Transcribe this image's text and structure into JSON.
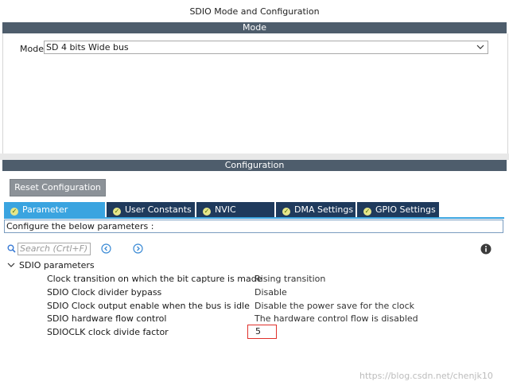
{
  "window": {
    "title": "SDIO Mode and Configuration"
  },
  "mode_section": {
    "header": "Mode",
    "mode_label": "Mode",
    "mode_value": "SD 4 bits Wide bus"
  },
  "config_section": {
    "header": "Configuration",
    "reset_button": "Reset Configuration",
    "tabs": [
      {
        "label": "Parameter Settings",
        "active": true
      },
      {
        "label": "User Constants",
        "active": false
      },
      {
        "label": "NVIC Settings",
        "active": false
      },
      {
        "label": "DMA Settings",
        "active": false
      },
      {
        "label": "GPIO Settings",
        "active": false
      }
    ],
    "configure_text": "Configure the below parameters :",
    "search_placeholder": "Search (Crtl+F)",
    "group_label": "SDIO parameters",
    "parameters": [
      {
        "name": "Clock transition on which the bit capture is made",
        "value": "Rising transition"
      },
      {
        "name": "SDIO Clock divider bypass",
        "value": "Disable"
      },
      {
        "name": "SDIO Clock output enable when the bus is idle",
        "value": "Disable the power save for the clock"
      },
      {
        "name": "SDIO hardware flow control",
        "value": "The hardware control flow is disabled"
      },
      {
        "name": "SDIOCLK clock divide factor",
        "value": "5"
      }
    ]
  },
  "watermark": "https://blog.csdn.net/chenjk10",
  "colors": {
    "section_header": "#4e5d6c",
    "tab_inactive": "#1f3a5c",
    "tab_active": "#3aa4e0",
    "highlight_box": "#e0302a"
  },
  "icons": [
    "search-icon",
    "chevron-down-icon",
    "arrow-left-circle-icon",
    "arrow-right-circle-icon",
    "info-icon",
    "check-circle-icon",
    "tree-collapse-icon"
  ]
}
